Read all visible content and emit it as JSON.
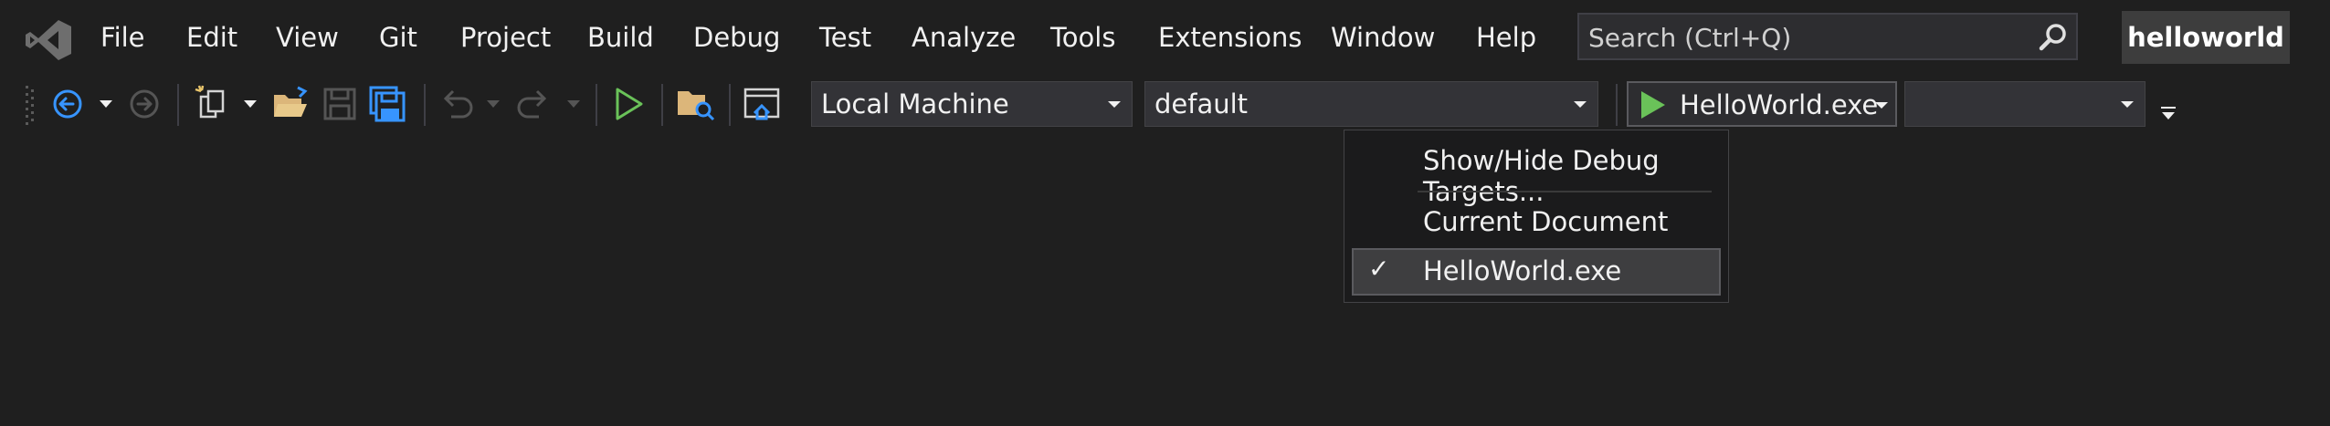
{
  "menubar": {
    "logo_icon": "visual-studio-logo-icon",
    "items": [
      "File",
      "Edit",
      "View",
      "Git",
      "Project",
      "Build",
      "Debug",
      "Test",
      "Analyze",
      "Tools",
      "Extensions",
      "Window",
      "Help"
    ],
    "search": {
      "placeholder": "Search (Ctrl+Q)",
      "icon": "search-icon"
    },
    "project_name": "helloworld"
  },
  "toolbar": {
    "icons": [
      "back-navigate-icon",
      "forward-navigate-icon",
      "new-project-icon",
      "open-file-icon",
      "save-icon",
      "save-all-icon",
      "undo-icon",
      "redo-icon",
      "start-without-debugging-icon",
      "solution-explorer-icon",
      "web-browser-icon"
    ],
    "target_platform": "Local Machine",
    "configuration": "default",
    "startup_item": "HelloWorld.exe",
    "extra_combo": "",
    "overflow_icon": "toolbar-overflow-icon"
  },
  "dropdown": {
    "items": [
      {
        "label": "Show/Hide Debug Targets...",
        "checked": false
      },
      {
        "label": "Current Document",
        "checked": false
      },
      {
        "label": "HelloWorld.exe",
        "checked": true
      }
    ],
    "check_glyph": "✓"
  },
  "colors": {
    "background": "#1f1f1f",
    "accent_blue": "#3794ff",
    "run_green": "#6ac259",
    "folder_yellow": "#dcb67a"
  }
}
